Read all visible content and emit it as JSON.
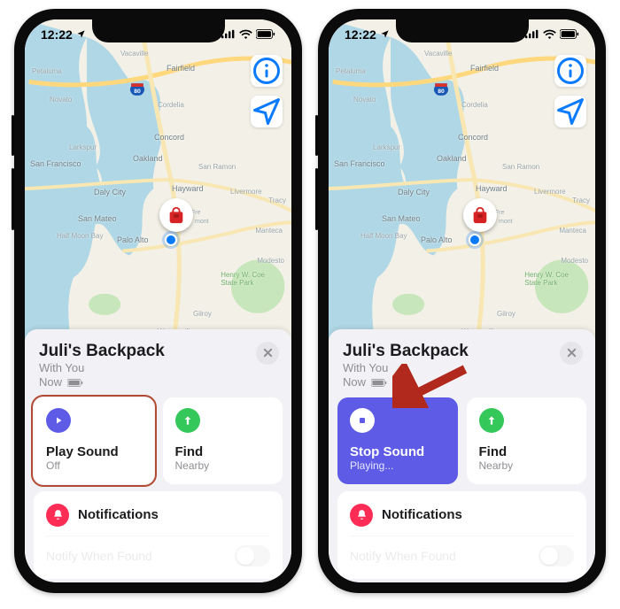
{
  "statusbar": {
    "time": "12:22",
    "location_arrow": true
  },
  "sheet": {
    "title": "Juli's Backpack",
    "subtitle_line1": "With You",
    "subtitle_line2": "Now"
  },
  "map": {
    "info_button": "i",
    "location_button": "locate",
    "highway_shield": "80",
    "labels": [
      "Vacaville",
      "Fairfield",
      "Petaluma",
      "Novato",
      "Concord",
      "San Francisco",
      "Oakland",
      "San Ramon",
      "Hayward",
      "Daly City",
      "San Mateo",
      "Palo Alto",
      "Livermore",
      "Tracy",
      "Manteca",
      "Gilroy",
      "Watsonville",
      "Modesto",
      "Henry W. Coe State Park",
      "Fremont",
      "Cordelia",
      "Larkspur",
      "Half Moon Bay"
    ]
  },
  "dual": {
    "left": {
      "playcard": {
        "title": "Play Sound",
        "sub": "Off",
        "active": false,
        "highlight": true
      }
    },
    "right": {
      "playcard": {
        "title": "Stop Sound",
        "sub": "Playing...",
        "active": true,
        "highlight": false,
        "arrow": true
      }
    }
  },
  "findcard": {
    "title": "Find",
    "sub": "Nearby"
  },
  "notifications": {
    "header": "Notifications",
    "row_label": "Notify When Found"
  }
}
